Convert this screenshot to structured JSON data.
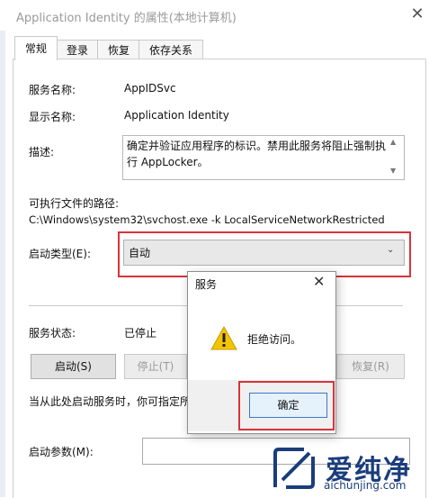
{
  "window": {
    "title": "Application Identity 的属性(本地计算机)"
  },
  "tabs": [
    {
      "label": "常规",
      "active": true
    },
    {
      "label": "登录"
    },
    {
      "label": "恢复"
    },
    {
      "label": "依存关系"
    }
  ],
  "general": {
    "service_name_label": "服务名称:",
    "service_name_value": "AppIDSvc",
    "display_name_label": "显示名称:",
    "display_name_value": "Application Identity",
    "description_label": "描述:",
    "description_value": "确定并验证应用程序的标识。禁用此服务将阻止强制执行 AppLocker。",
    "exe_path_label": "可执行文件的路径:",
    "exe_path_value": "C:\\Windows\\system32\\svchost.exe -k LocalServiceNetworkRestricted",
    "startup_type_label": "启动类型(E):",
    "startup_type_value": "自动",
    "service_status_label": "服务状态:",
    "service_status_value": "已停止",
    "start_button": "启动(S)",
    "stop_button": "停止(T)",
    "resume_button": "恢复(R)",
    "hint_text": "当从此处启动服务时，你可指定所",
    "start_params_label": "启动参数(M):"
  },
  "dialog": {
    "title": "服务",
    "message": "拒绝访问。",
    "ok_button": "确定"
  },
  "watermark": {
    "brand": "爱纯净",
    "url": "aichunjing.com"
  },
  "colors": {
    "highlight_red": "#d8333a",
    "warning_yellow": "#f5c400",
    "brand_blue": "#1a3d7c"
  }
}
